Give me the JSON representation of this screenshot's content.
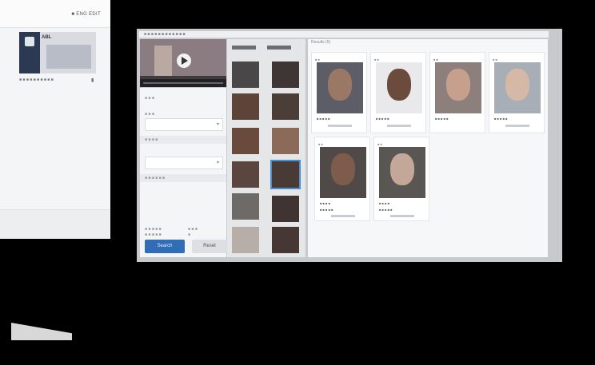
{
  "left_panel": {
    "header_text": "■ ENG EDIT",
    "thumb_tag": "ABL",
    "caption": "■ ■ ■ ■ ■ ■ ■ ■ ■ ■",
    "caption_icon": "▮"
  },
  "app": {
    "titlebar": "■ ■ ■ ■ ■ ■ ■ ■ ■ ■ ■ ■",
    "results_title": "Results (6)",
    "form": {
      "label_1": "■ ■ ■",
      "label_2": "■ ■ ■",
      "section_1": "■ ■ ■ ■",
      "section_2": "■ ■ ■ ■ ■ ■",
      "stat_label_1": "■ ■ ■ ■ ■",
      "stat_value_1": "■ ■ ■",
      "stat_label_2": "■ ■ ■ ■ ■",
      "stat_value_2": "■"
    },
    "search_button": "Search",
    "reset_button": "Reset",
    "cards": [
      {
        "tag": "■ ■",
        "name": "",
        "match": "■ ■ ■ ■ ■"
      },
      {
        "tag": "■ ■",
        "name": "",
        "match": "■ ■ ■ ■ ■"
      },
      {
        "tag": "■ ■",
        "name": "",
        "match": "■ ■ ■ ■ ■"
      },
      {
        "tag": "■ ■",
        "name": "",
        "match": "■ ■ ■ ■ ■"
      },
      {
        "tag": "■ ■",
        "name": "■ ■ ■ ■",
        "match": "■ ■ ■ ■ ■"
      },
      {
        "tag": "■ ■",
        "name": "■ ■ ■ ■",
        "match": "■ ■ ■ ■ ■"
      }
    ]
  },
  "icons": {
    "play": "play-icon",
    "dropdown": "chevron-down-icon"
  },
  "colors": {
    "accent": "#2f6db6",
    "selection": "#4b8fd3"
  }
}
